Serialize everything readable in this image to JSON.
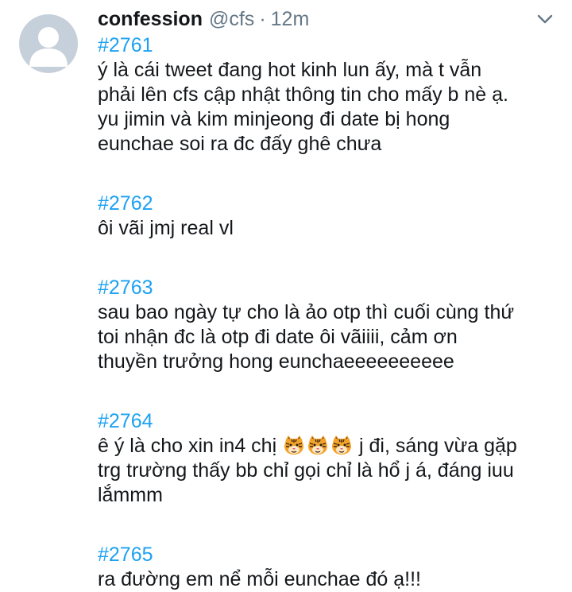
{
  "author": {
    "display_name": "confession",
    "handle": "@cfs",
    "separator": "·",
    "time": "12m"
  },
  "icons": {
    "avatar": "default-profile-icon",
    "menu": "chevron-down-icon",
    "emoji": "tiger-face-icon"
  },
  "colors": {
    "link": "#1da1f2",
    "text": "#14171a",
    "muted": "#657786",
    "avatar_bg": "#c6d0db"
  },
  "posts": [
    {
      "number": "#2761",
      "lines": [
        "ý là cái tweet đang hot kinh lun ấy, mà t vẫn",
        "phải lên cfs cập nhật thông tin cho mấy b nè ạ.",
        "yu jimin và kim minjeong đi date bị hong",
        "eunchae soi ra đc đấy ghê chưa"
      ]
    },
    {
      "number": "#2762",
      "lines": [
        "ôi vãi jmj real vl"
      ]
    },
    {
      "number": "#2763",
      "lines": [
        "sau bao ngày tự cho là ảo otp thì cuối cùng thứ",
        "toi nhận đc là otp đi date ôi vãiiii, cảm ơn",
        "thuyền trưởng hong eunchaeeeeeeeeee"
      ]
    },
    {
      "number": "#2764",
      "line1_before": "ê ý là cho xin in4 chị",
      "line1_after": "j đi, sáng vừa gặp",
      "lines_rest": [
        "trg trường thấy bb chỉ gọi chỉ là hổ j á, đáng iuu",
        "lắmmm"
      ]
    },
    {
      "number": "#2765",
      "lines": [
        "ra đường em nể mỗi eunchae đó ạ!!!"
      ]
    }
  ]
}
